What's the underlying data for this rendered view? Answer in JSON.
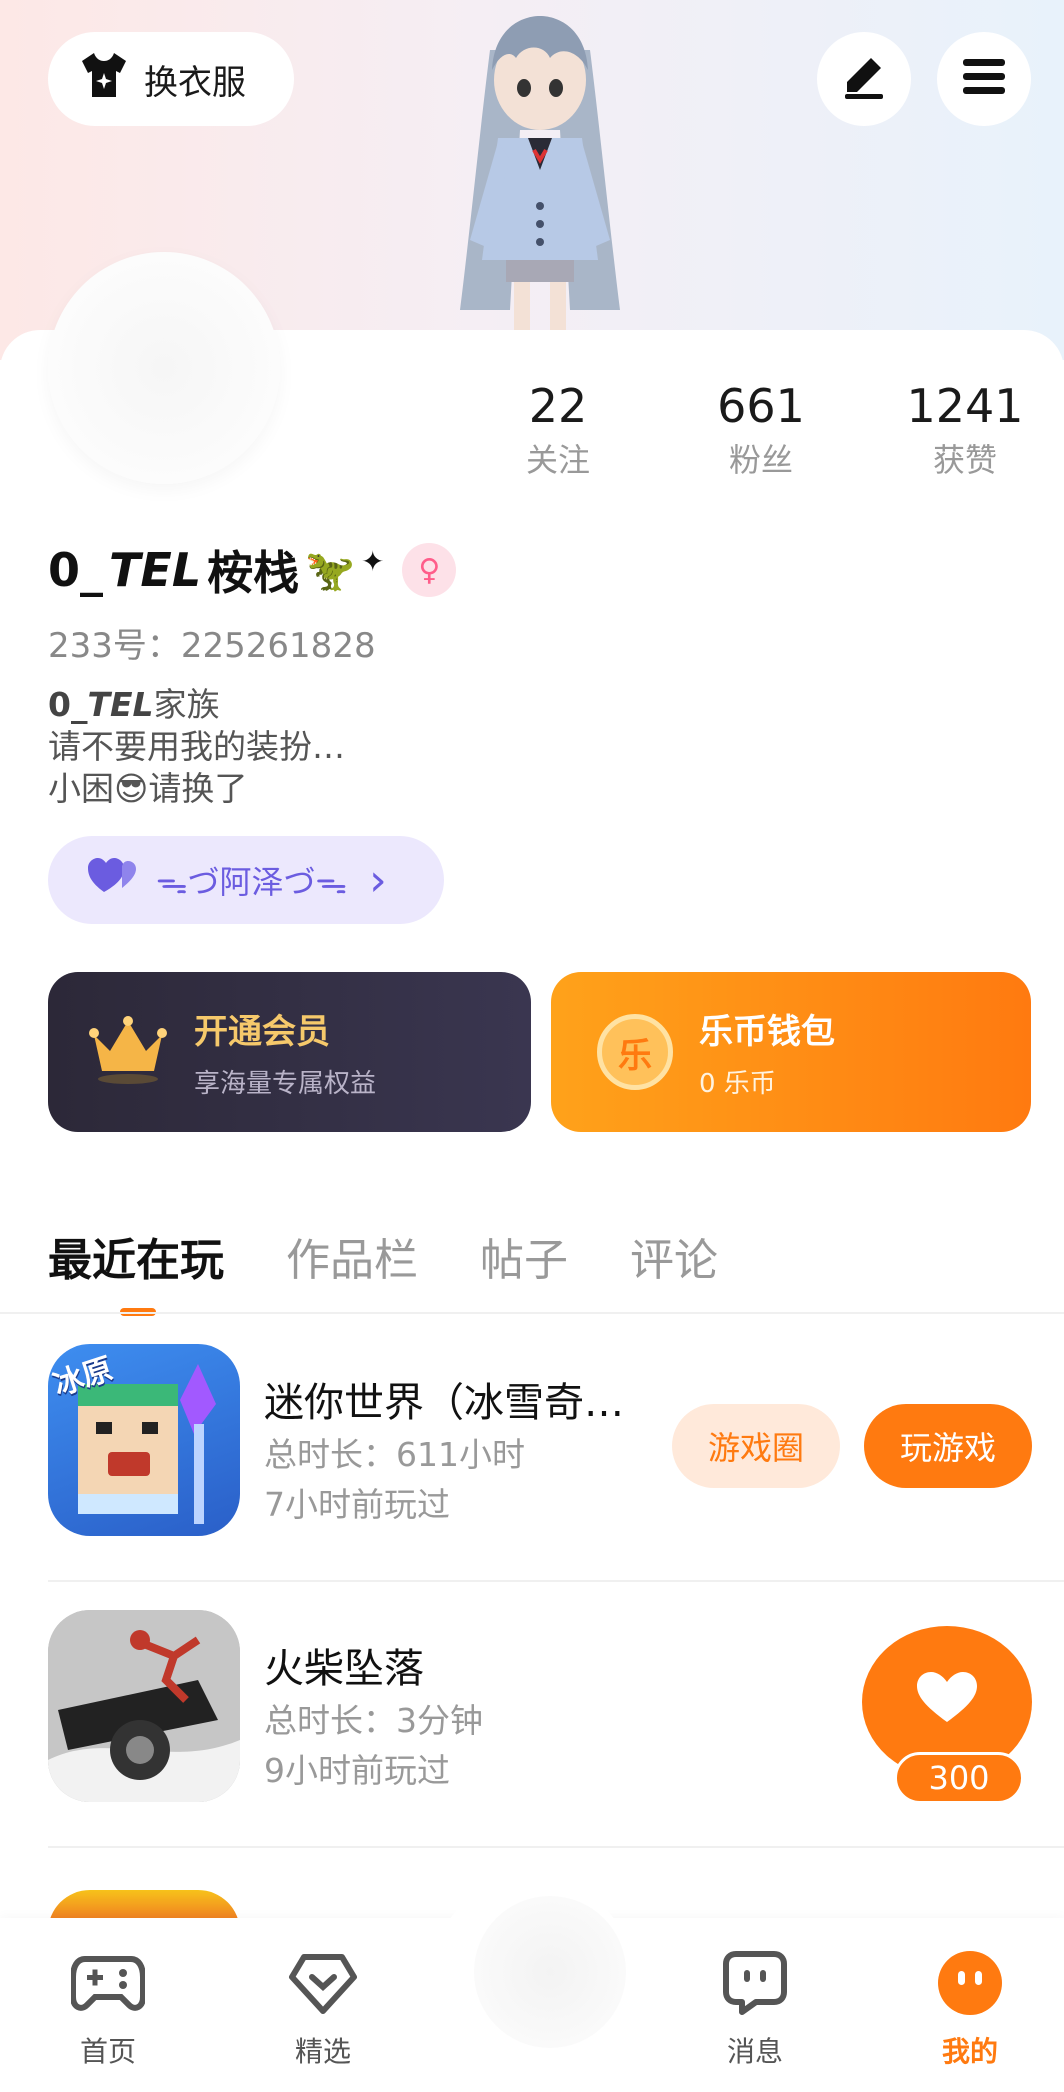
{
  "header": {
    "outfit_button_label": "换衣服",
    "outfit_icon": "tshirt-icon",
    "edit_icon": "pen-icon",
    "menu_icon": "hamburger-menu-icon"
  },
  "profile": {
    "stats": [
      {
        "value": "22",
        "label": "关注"
      },
      {
        "value": "661",
        "label": "粉丝"
      },
      {
        "value": "1241",
        "label": "获赞"
      }
    ],
    "name_prefix": "0_",
    "name_italic": "TEL",
    "name_suffix": "桉栈",
    "name_emoji": "🦖",
    "gender": "female",
    "uid_text": "233号：225261828",
    "bio_family_zero": "0_",
    "bio_family_tel": "TEL",
    "bio_family_suffix": "家族",
    "bio_line2": "请不要用我的装扮…",
    "bio_line3": "小困😎请换了",
    "relation_label": "ᯓづ阿泽づᯓ",
    "relation_chevron": "›"
  },
  "cards": {
    "vip_title": "开通会员",
    "vip_subtitle": "享海量专属权益",
    "wallet_title": "乐币钱包",
    "wallet_subtitle": "0 乐币",
    "wallet_coin_char": "乐"
  },
  "tabs": [
    {
      "label": "最近在玩",
      "active": true
    },
    {
      "label": "作品栏",
      "active": false
    },
    {
      "label": "帖子",
      "active": false
    },
    {
      "label": "评论",
      "active": false
    }
  ],
  "games": [
    {
      "name": "迷你世界（冰雪奇…",
      "duration": "总时长：611小时",
      "last_played": "7小时前玩过",
      "icon_badge": "冰原",
      "circle_button": "游戏圈",
      "play_button": "玩游戏"
    },
    {
      "name": "火柴坠落",
      "duration": "总时长：3分钟",
      "last_played": "9小时前玩过"
    }
  ],
  "like_float": {
    "count": "300"
  },
  "bottom_nav": [
    {
      "label": "首页",
      "icon": "gamepad-icon",
      "active": false
    },
    {
      "label": "精选",
      "icon": "heart-diamond-icon",
      "active": false
    },
    {
      "label": "消息",
      "icon": "chat-bubble-icon",
      "active": false
    },
    {
      "label": "我的",
      "icon": "profile-face-icon",
      "active": true
    }
  ],
  "colors": {
    "accent": "#ff7a10",
    "vip_gold": "#f6c96b",
    "relation_purple": "#6b5ce0"
  }
}
